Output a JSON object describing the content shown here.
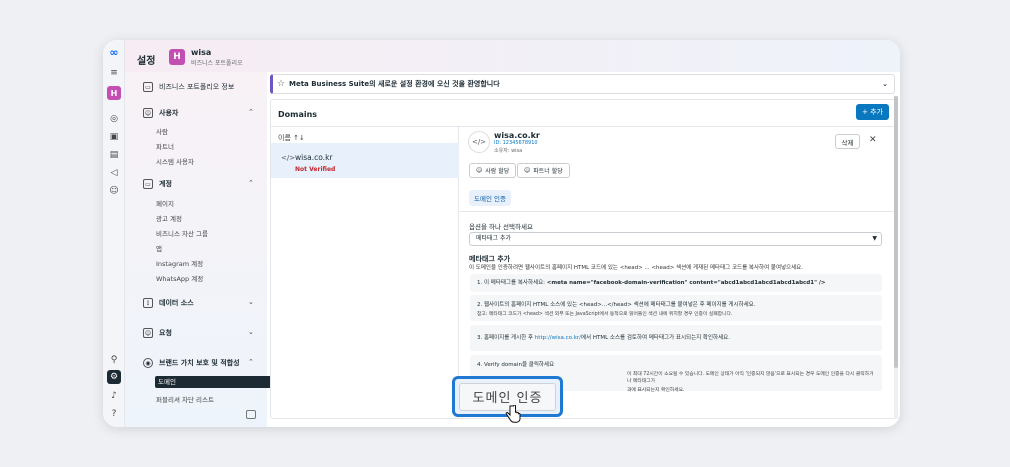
{
  "header": {
    "title": "설정",
    "badge_letter": "H",
    "business_name": "wisa",
    "business_sub": "비즈니스 포트폴리오"
  },
  "rail": {
    "badge_letter": "H",
    "help": "?"
  },
  "sidebar": {
    "portfolio_info": "비즈니스 포트폴리오 정보",
    "users": {
      "label": "사용자",
      "items": [
        "사람",
        "파트너",
        "시스템 사용자"
      ]
    },
    "accounts": {
      "label": "계정",
      "items": [
        "페이지",
        "광고 계정",
        "비즈니스 자산 그룹",
        "앱",
        "Instagram 계정",
        "WhatsApp 계정"
      ]
    },
    "data_sources": "데이터 소스",
    "requests": "요청",
    "brand_safety": {
      "label": "브랜드 가치 보호 및 적합성",
      "active": "도메인",
      "block_list": "퍼블리셔 차단 리스트"
    }
  },
  "banner": {
    "text": "Meta Business Suite의 새로운 설정 환경에 오신 것을 환영합니다"
  },
  "domains": {
    "title": "Domains",
    "add_label": "+ 추가",
    "list_header": "이름 ↑↓",
    "rows": [
      {
        "icon": "</>",
        "name": "wisa.co.kr",
        "status": "Not Verified"
      }
    ]
  },
  "detail": {
    "icon": "</>",
    "name": "wisa.co.kr",
    "id_line": "ID: 12345678910",
    "owner": "소유자: wisa",
    "delete_label": "삭제",
    "close": "✕",
    "assign_people": "사람 할당",
    "assign_partner": "파트너 할당",
    "tab": "도메인 인증",
    "option_label": "옵션을 하나 선택하세요",
    "select_value": "메타태그 추가",
    "meta_title": "메타태그 추가",
    "meta_desc": "이 도메인을 인증하려면 웹사이트의 홈페이지 HTML 코드에 있는 <head> ... <head> 섹션에 게재된 메타태그 코드를 복사하여 붙여넣으세요.",
    "step1_prefix": "1. 이 메타태그를 복사하세요: ",
    "step1_code": "<meta name=\"facebook-domain-verification\" content=\"abcd1abcd1abcd1abcd1abcd1\" />",
    "step2": "2. 웹사이트의 홈페이지 HTML 소스에 있는 <head>...</head> 섹션에 메타태그를 붙여넣은 후 페이지를 게시하세요.",
    "step2_sub": "참고: 메타태그 코드가 <head> 섹션 외부 또는 JavaScript에서 동적으로 읽어들인 섹션 내에 위치할 경우 인증이 실패합니다.",
    "step3_prefix": "3. 홈페이지를 게시한 후 ",
    "step3_link": "http://wisa.co.kr/",
    "step3_suffix": "에서 HTML 소스를 검토하여 메타태그가 표시되는지 확인하세요.",
    "step4": "4. Verify domain을 클릭하세요",
    "step4_sub": "이 최대 72시간이 소요될 수 있습니다. 도메인 상태가 아직 '인증되지 않음'으로 표시되는 경우 도메인 인증을 다시 클릭하거나 메타태그가",
    "step4_sub2": "과에 표시되는지 확인하세요."
  },
  "callout": {
    "label": "도메인 인증"
  },
  "colors": {
    "accent": "#0a78be",
    "highlight": "#1f78d1",
    "active_nav": "#1c2b33",
    "brand_badge": "#c44fb3",
    "not_verified": "#c0272d"
  }
}
